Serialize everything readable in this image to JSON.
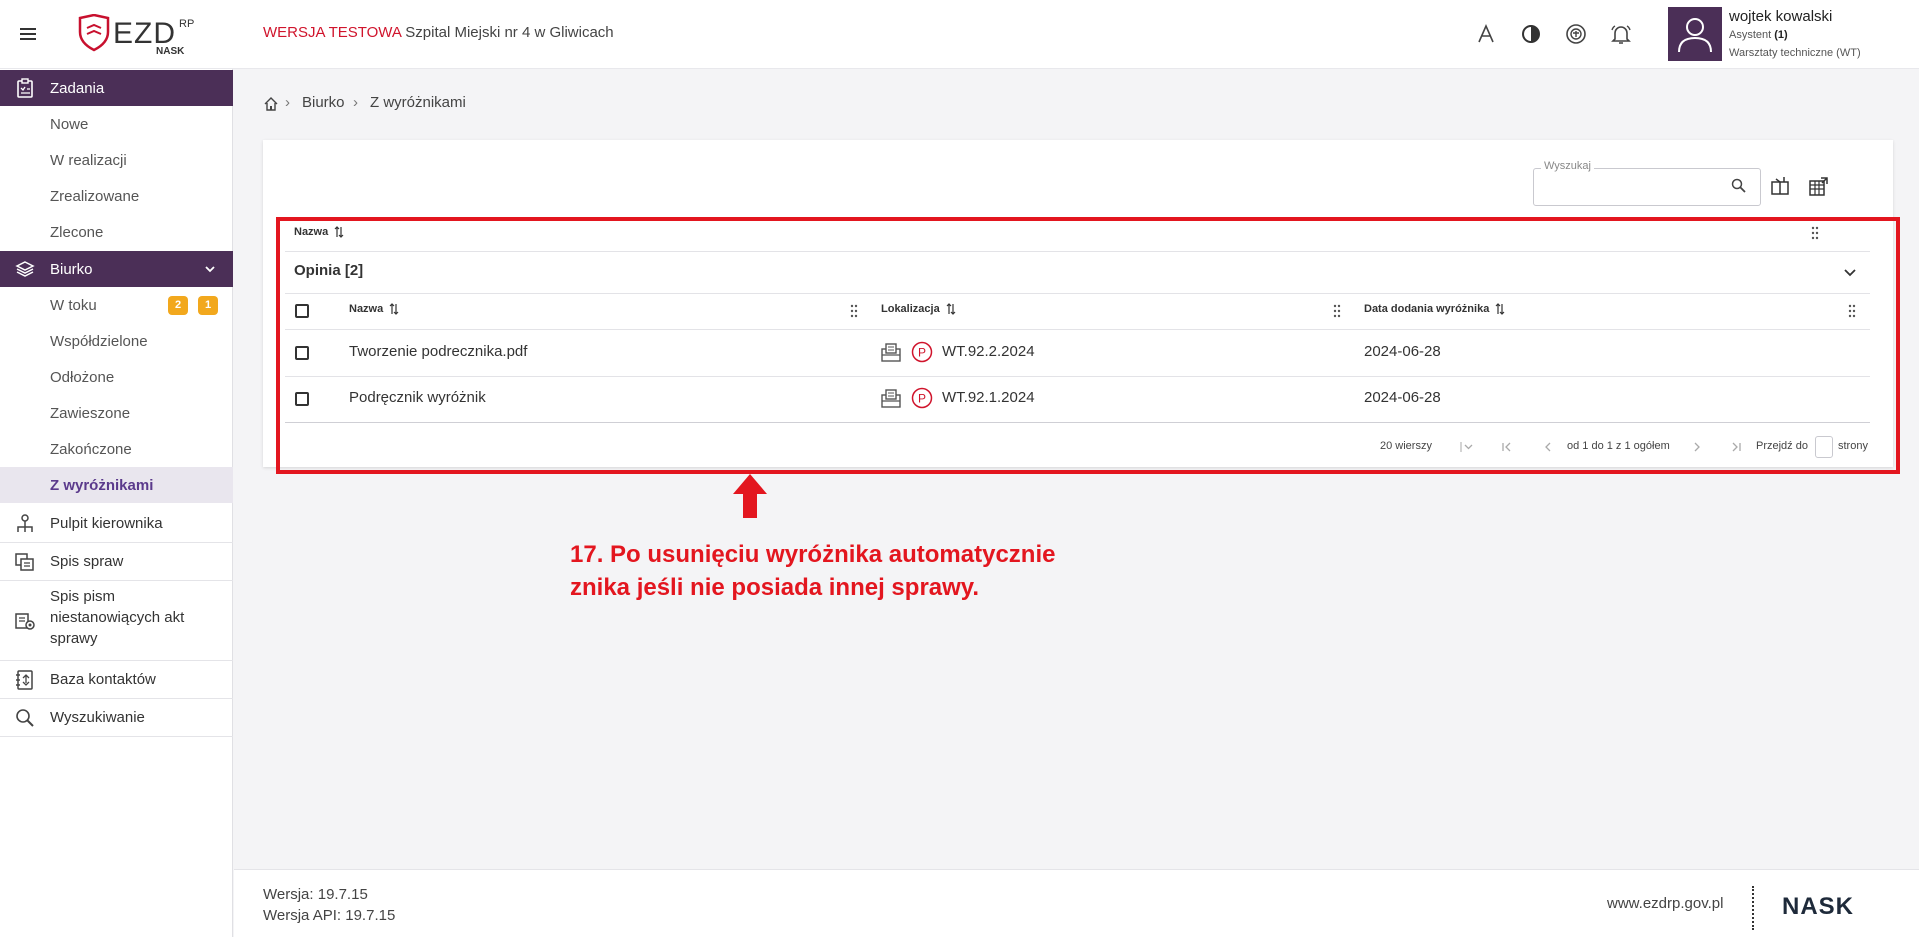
{
  "header": {
    "env_label": "WERSJA TESTOWA",
    "org_name": "Szpital Miejski nr 4 w Gliwicach",
    "logo_text": "EZD",
    "logo_sup": "RP",
    "logo_sub": "NASK",
    "user": {
      "name": "wojtek kowalski",
      "role": "Asystent",
      "role_count": "(1)",
      "unit": "Warsztaty techniczne (WT)"
    }
  },
  "sidebar": {
    "zadania": {
      "label": "Zadania",
      "items": [
        "Nowe",
        "W realizacji",
        "Zrealizowane",
        "Zlecone"
      ]
    },
    "biurko": {
      "label": "Biurko",
      "items": [
        "W toku",
        "Współdzielone",
        "Odłożone",
        "Zawieszone",
        "Zakończone",
        "Z wyróżnikami"
      ],
      "w_toku_badges": [
        "2",
        "1"
      ]
    },
    "main_items": [
      "Pulpit kierownika",
      "Spis spraw",
      "Spis pism niestanowiących akt sprawy",
      "Baza kontaktów",
      "Wyszukiwanie"
    ]
  },
  "breadcrumb": [
    "Biurko",
    "Z wyróżnikami"
  ],
  "toolbar": {
    "search_label": "Wyszukaj",
    "search_value": ""
  },
  "grid": {
    "group_by_header": "Nazwa",
    "group_label": "Opinia [2]",
    "columns": [
      "Nazwa",
      "Lokalizacja",
      "Data dodania wyróżnika"
    ],
    "rows": [
      {
        "name": "Tworzenie podrecznika.pdf",
        "location": "WT.92.2.2024",
        "date": "2024-06-28"
      },
      {
        "name": "Podręcznik wyróżnik",
        "location": "WT.92.1.2024",
        "date": "2024-06-28"
      }
    ],
    "pager": {
      "rows_per_page": "20 wierszy",
      "range": "od 1 do 1 z 1 ogółem",
      "goto_label": "Przejdź do",
      "pages_label": "strony"
    }
  },
  "annotation": {
    "line1": "17. Po usunięciu wyróżnika automatycznie",
    "line2": "znika jeśli nie posiada innej sprawy."
  },
  "footer": {
    "version": "Wersja: 19.7.15",
    "api_version": "Wersja API: 19.7.15",
    "site": "www.ezdrp.gov.pl",
    "brand": "NASK"
  },
  "colors": {
    "brand_purple": "#4b2f57",
    "alert_red": "#e3161f",
    "badge_orange": "#f2a81d",
    "env_red": "#d0142c"
  }
}
